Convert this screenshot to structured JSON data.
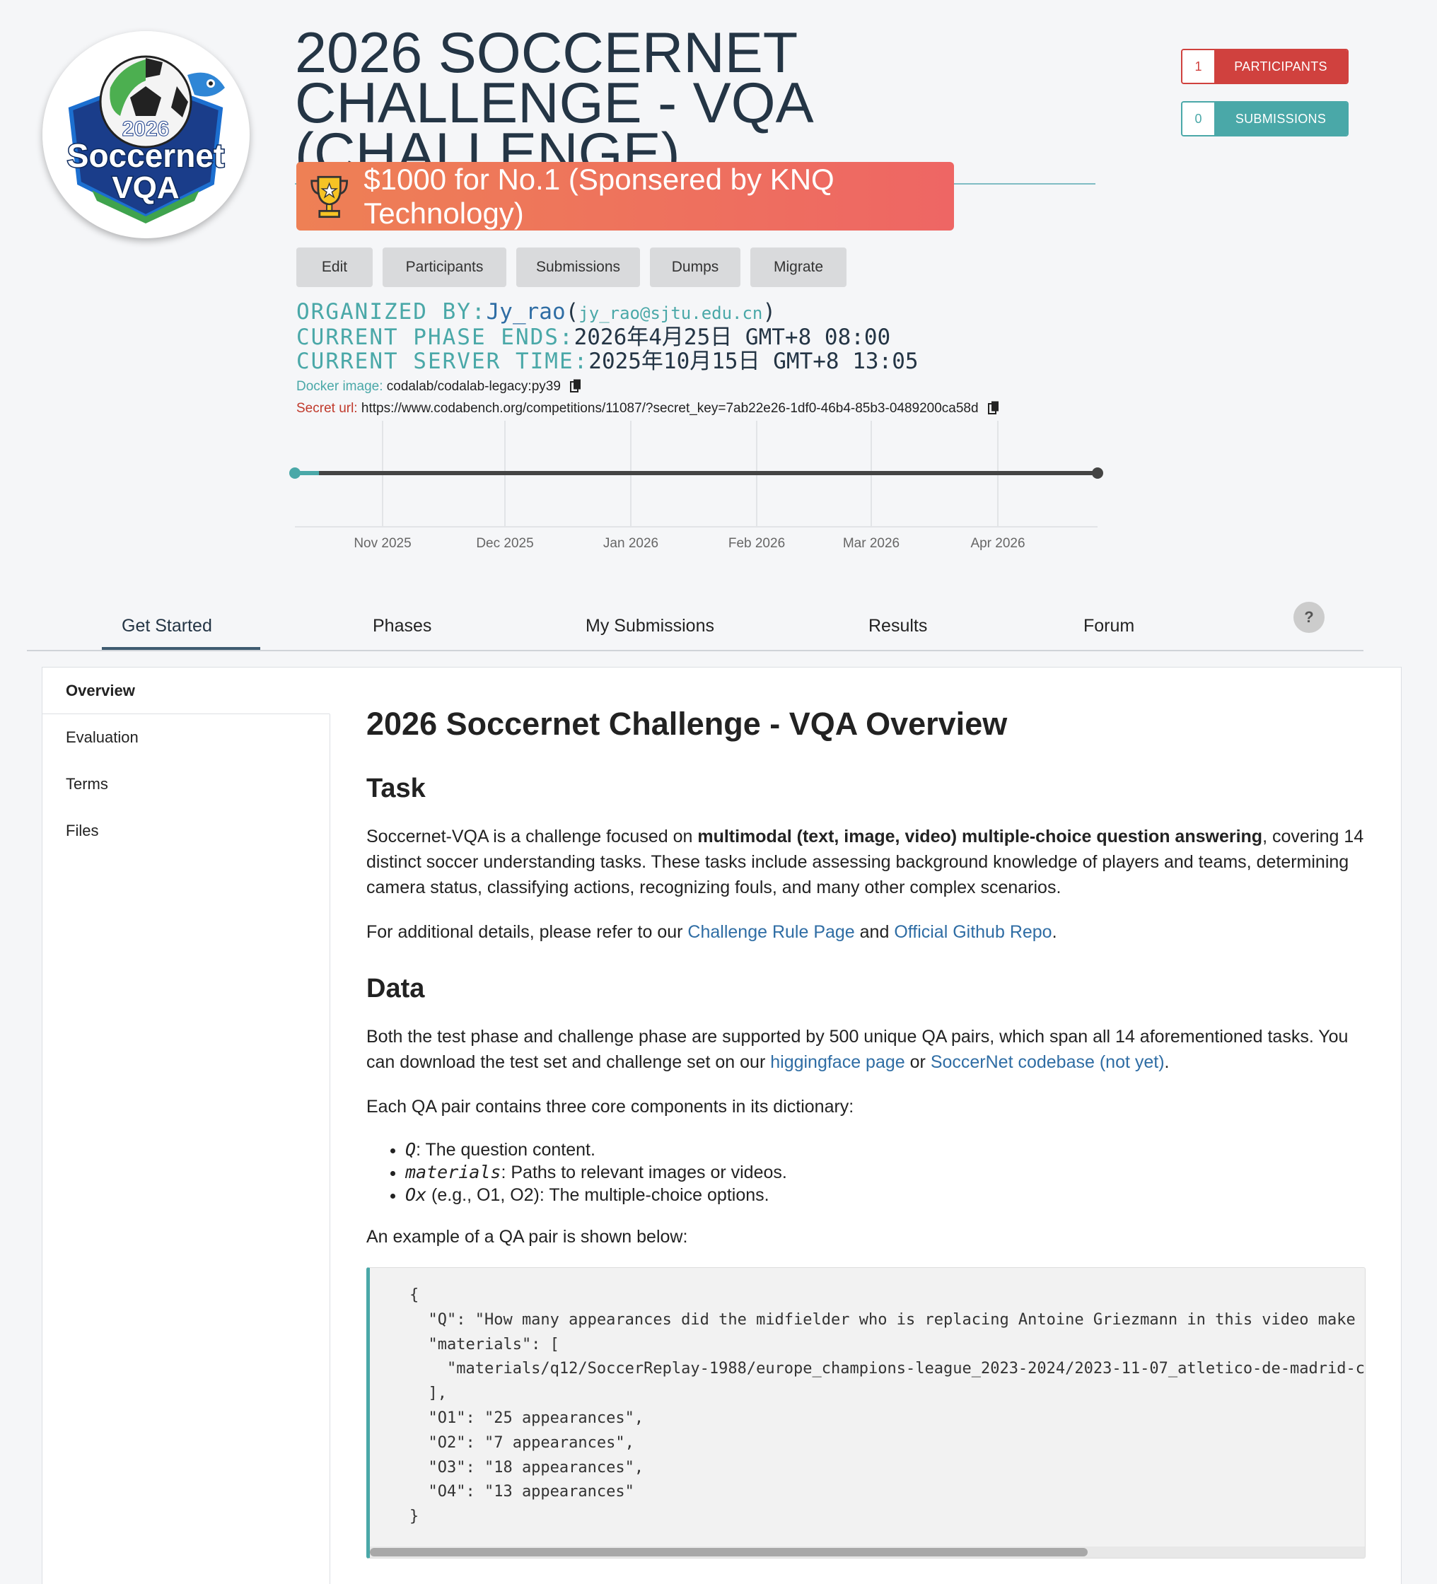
{
  "header": {
    "title": "2026 SOCCERNET CHALLENGE - VQA (CHALLENGE)",
    "logo": {
      "year": "2026",
      "line1": "Soccernet",
      "line2": "VQA"
    },
    "participants": {
      "count": "1",
      "label": "PARTICIPANTS",
      "color": "#d0413e"
    },
    "submissions": {
      "count": "0",
      "label": "SUBMISSIONS",
      "color": "#4aa8a8"
    },
    "prize": "$1000 for No.1 (Sponsered by KNQ Technology)",
    "buttons": [
      "Edit",
      "Participants",
      "Submissions",
      "Dumps",
      "Migrate"
    ],
    "organized_by_label": "ORGANIZED BY:",
    "organizer": "Jy_rao",
    "organizer_email": "jy_rao@sjtu.edu.cn",
    "phase_ends_label": "CURRENT PHASE ENDS:",
    "phase_ends": "2026年4月25日 GMT+8 08:00",
    "server_time_label": "CURRENT SERVER TIME:",
    "server_time": "2025年10月15日 GMT+8 13:05",
    "docker_label": "Docker image:",
    "docker_image": "codalab/codalab-legacy:py39",
    "secret_label": "Secret url:",
    "secret_url": "https://www.codabench.org/competitions/11087/?secret_key=7ab22e26-1df0-46b4-85b3-0489200ca58d"
  },
  "timeline": {
    "months": [
      "Nov 2025",
      "Dec 2025",
      "Jan 2026",
      "Feb 2026",
      "Mar 2026",
      "Apr 2026"
    ],
    "progress_fraction": 0.03
  },
  "tabs": [
    "Get Started",
    "Phases",
    "My Submissions",
    "Results",
    "Forum"
  ],
  "help_label": "?",
  "sidebar": [
    "Overview",
    "Evaluation",
    "Terms",
    "Files"
  ],
  "content": {
    "title": "2026 Soccernet Challenge - VQA Overview",
    "task_heading": "Task",
    "task_p1_a": "Soccernet-VQA is a challenge focused on ",
    "task_p1_bold": "multimodal (text, image, video) multiple-choice question answering",
    "task_p1_b": ", covering 14 distinct soccer understanding tasks. These tasks include assessing background knowledge of players and teams, determining camera status, classifying actions, recognizing fouls, and many other complex scenarios.",
    "task_p2_a": "For additional details, please refer to our ",
    "task_p2_link1": "Challenge Rule Page",
    "task_p2_b": " and ",
    "task_p2_link2": "Official Github Repo",
    "task_p2_c": ".",
    "data_heading": "Data",
    "data_p1_a": "Both the test phase and challenge phase are supported by 500 unique QA pairs, which span all 14 aforementioned tasks. You can download the test set and challenge set on our ",
    "data_p1_link1": "higgingface page",
    "data_p1_b": " or ",
    "data_p1_link2": "SoccerNet codebase (not yet)",
    "data_p1_c": ".",
    "data_p2": "Each QA pair contains three core components in its dictionary:",
    "bullets": [
      {
        "code": "Q",
        "text": ": The question content."
      },
      {
        "code": "materials",
        "text": ": Paths to relevant images or videos."
      },
      {
        "code": "Ox",
        "text": " (e.g., O1, O2): The multiple-choice options."
      }
    ],
    "example_intro": "An example of a QA pair is shown below:",
    "code": "{\n  \"Q\": \"How many appearances did the midfielder who is replacing Antoine Griezmann in this video make f\n  \"materials\": [\n    \"materials/q12/SoccerReplay-1988/europe_champions-league_2023-2024/2023-11-07_atletico-de-madrid-ce\n  ],\n  \"O1\": \"25 appearances\",\n  \"O2\": \"7 appearances\",\n  \"O3\": \"18 appearances\",\n  \"O4\": \"13 appearances\"\n}"
  }
}
